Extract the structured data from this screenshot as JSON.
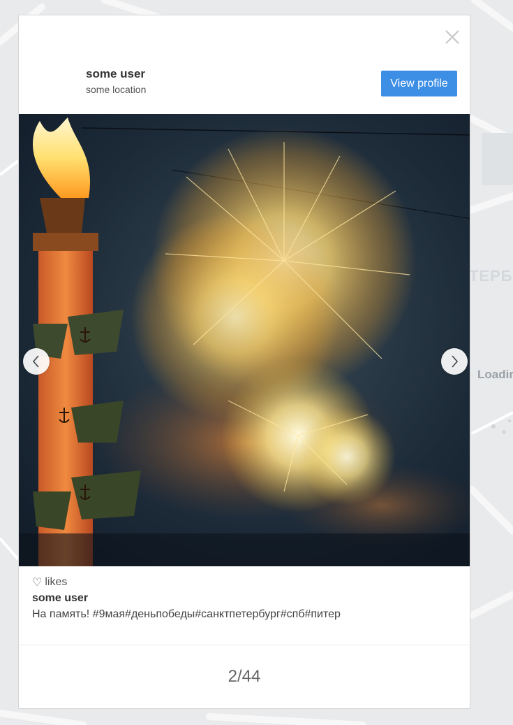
{
  "background": {
    "map_label": "ТЕРБ",
    "loading_text": "Loadir"
  },
  "modal": {
    "user": {
      "name": "some user",
      "location": "some location"
    },
    "view_profile_label": "View profile",
    "close_icon": "close-icon",
    "photo": {
      "description_icon": "fireworks-photo"
    },
    "prev_icon": "chevron-left-icon",
    "next_icon": "chevron-right-icon",
    "likes": {
      "icon": "heart-icon",
      "glyph": "♡",
      "label": "likes"
    },
    "caption": {
      "user": "some user",
      "text": "На память! #9мая#деньпобеды#санктпетербург#спб#питер"
    },
    "counter": "2/44"
  },
  "colors": {
    "accent": "#3d8fe6",
    "modal_bg": "#ffffff",
    "page_bg": "#e9eaeb"
  }
}
